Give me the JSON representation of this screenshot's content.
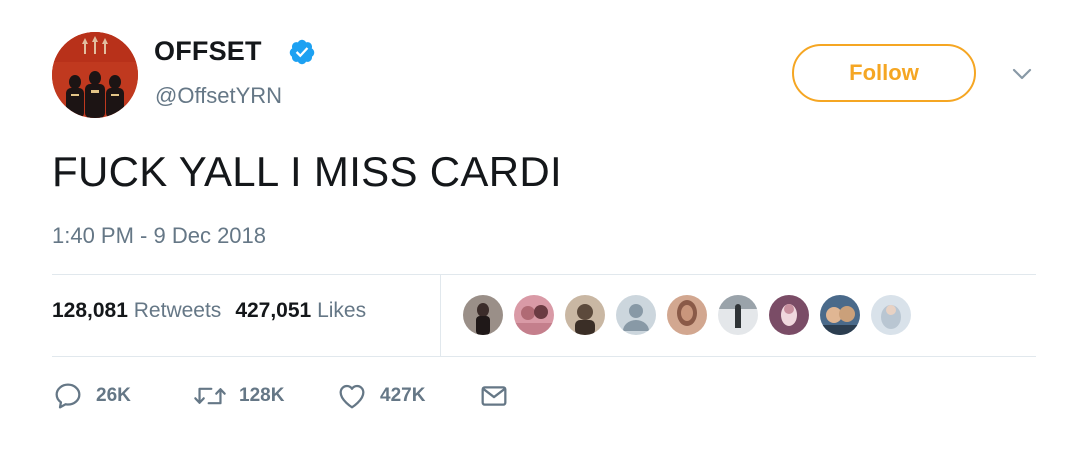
{
  "user": {
    "name": "OFFSET",
    "handle": "@OffsetYRN",
    "verified": true,
    "avatar_icon": "profile-photo"
  },
  "follow": {
    "label": "Follow",
    "color": "#f5a623"
  },
  "tweet": {
    "text": "FUCK YALL I MISS CARDI",
    "timestamp": "1:40 PM - 9 Dec 2018"
  },
  "stats": {
    "retweets_count": "128,081",
    "retweets_label": "Retweets",
    "likes_count": "427,051",
    "likes_label": "Likes"
  },
  "likers": [
    {
      "icon": "user-avatar",
      "color": "#3b2c2a"
    },
    {
      "icon": "user-avatar",
      "color": "#b06a74"
    },
    {
      "icon": "user-avatar",
      "color": "#5c4a3c"
    },
    {
      "icon": "default-avatar",
      "color": "#ccd6dd"
    },
    {
      "icon": "user-avatar",
      "color": "#8a5a48"
    },
    {
      "icon": "user-avatar",
      "color": "#6e7478"
    },
    {
      "icon": "user-avatar",
      "color": "#7a4c66"
    },
    {
      "icon": "user-avatar",
      "color": "#4a6a8a"
    },
    {
      "icon": "user-avatar",
      "color": "#c9d3dc"
    }
  ],
  "actions": {
    "reply_count": "26K",
    "retweet_count": "128K",
    "like_count": "427K"
  },
  "colors": {
    "accent": "#f5a623",
    "secondary_text": "#657786",
    "verified_blue": "#1da1f2"
  }
}
